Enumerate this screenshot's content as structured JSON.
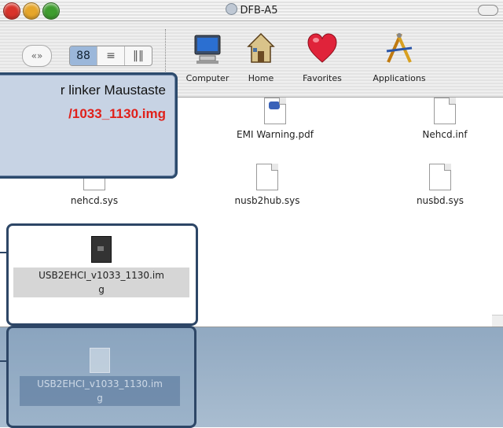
{
  "window": {
    "title": "DFB-A5"
  },
  "toolbar": {
    "nav_label": "«»",
    "view_buttons": [
      "88",
      "≡",
      "‖‖"
    ],
    "items": [
      {
        "label": "Computer",
        "icon": "computer-icon"
      },
      {
        "label": "Home",
        "icon": "home-icon"
      },
      {
        "label": "Favorites",
        "icon": "heart-icon"
      },
      {
        "label": "Applications",
        "icon": "applications-icon"
      }
    ]
  },
  "files": [
    {
      "name": "EMI Warning.pdf",
      "icon": "pdf-document-icon"
    },
    {
      "name": "Nehcd.inf",
      "icon": "document-icon"
    },
    {
      "name": "nehcd.sys",
      "icon": "document-icon"
    },
    {
      "name": "nusb2hub.sys",
      "icon": "document-icon"
    },
    {
      "name": "nusbd.sys",
      "icon": "document-icon"
    }
  ],
  "selected_file": {
    "name_line1": "USB2EHCI_v1033_1130.im",
    "name_line2": "g"
  },
  "dragged_file": {
    "name_line1": "USB2EHCI_v1033_1130.im",
    "name_line2": "g"
  },
  "callout": {
    "line1": "r linker Maustaste",
    "line2": "/1033_1130.img",
    "line2_color": "#e0201a"
  },
  "colors": {
    "frame": "#2d4666",
    "callout_bg": "#c7d3e4"
  }
}
